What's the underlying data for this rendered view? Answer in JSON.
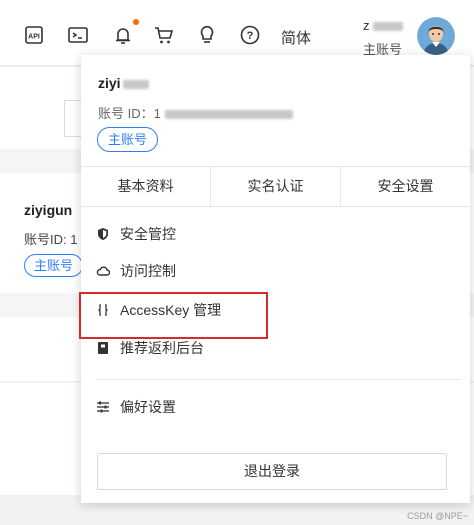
{
  "topbar": {
    "icons": [
      "api-icon",
      "terminal-icon",
      "bell-icon",
      "cart-icon",
      "lightbulb-icon",
      "help-icon"
    ],
    "language": "简体",
    "user_short": "z",
    "user_role": "主账号",
    "notification_dot_color": "#ff6a00"
  },
  "background": {
    "username": "ziyigun",
    "account_id_prefix": "账号ID: 1",
    "role_tag": "主账号"
  },
  "dropdown": {
    "username": "ziyi",
    "account_id_label": "账号 ID：1",
    "role_tag": "主账号",
    "tabs": [
      "基本资料",
      "实名认证",
      "安全设置"
    ],
    "menu": [
      {
        "label": "安全管控",
        "icon": "shield-icon"
      },
      {
        "label": "访问控制",
        "icon": "cloud-icon"
      },
      {
        "label": "AccessKey 管理",
        "icon": "key-icon"
      },
      {
        "label": "推荐返利后台",
        "icon": "reward-icon"
      },
      {
        "label": "偏好设置",
        "icon": "sliders-icon"
      }
    ],
    "logout": "退出登录"
  },
  "highlight_color": "#d9292c",
  "accent_color": "#2d7ff9",
  "watermark": "CSDN @NPE~"
}
